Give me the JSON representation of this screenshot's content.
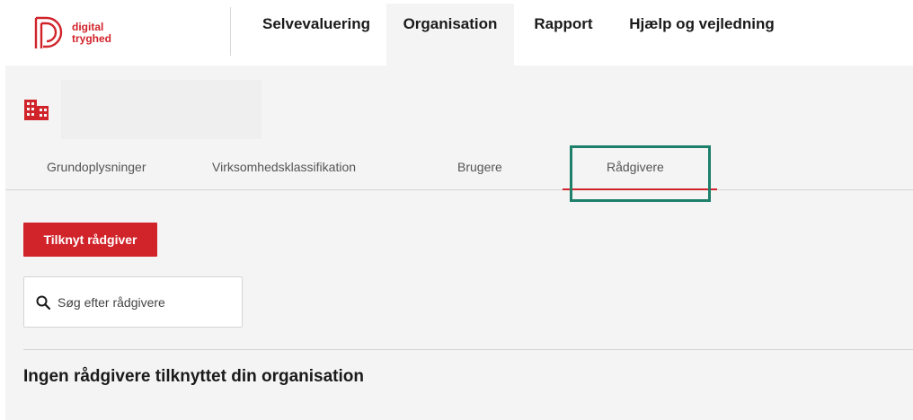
{
  "brand": {
    "line1": "digital",
    "line2": "tryghed",
    "color": "#d1232a"
  },
  "nav": {
    "items": [
      {
        "label": "Selvevaluering",
        "active": false
      },
      {
        "label": "Organisation",
        "active": true
      },
      {
        "label": "Rapport",
        "active": false
      },
      {
        "label": "Hjælp og vejledning",
        "active": false
      }
    ]
  },
  "org": {
    "icon": "building-icon",
    "name": ""
  },
  "tabs": [
    {
      "label": "Grundoplysninger",
      "active": false
    },
    {
      "label": "Virksomhedsklassifikation",
      "active": false
    },
    {
      "label": "Brugere",
      "active": false
    },
    {
      "label": "Rådgivere",
      "active": true
    }
  ],
  "actions": {
    "add_advisor_label": "Tilknyt rådgiver"
  },
  "search": {
    "placeholder": "Søg efter rådgivere",
    "value": "",
    "icon": "search-icon"
  },
  "empty_state": {
    "message": "Ingen rådgivere tilknyttet din organisation"
  },
  "colors": {
    "accent": "#d1232a",
    "highlight": "#1e7f6b",
    "background": "#f3f4f3"
  }
}
